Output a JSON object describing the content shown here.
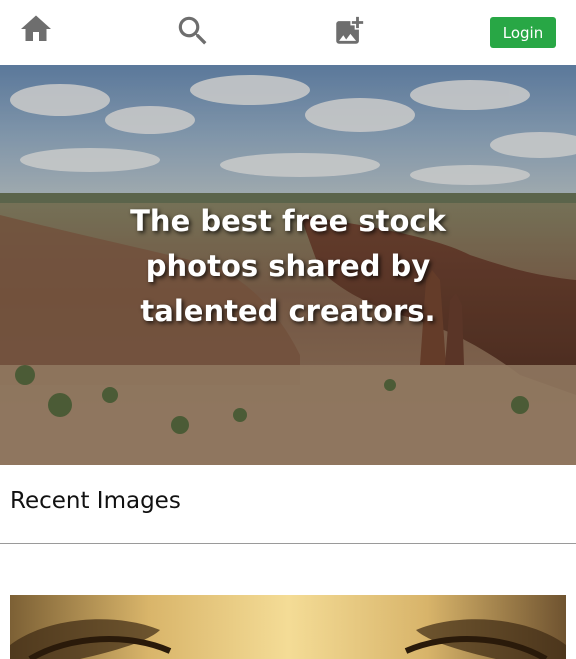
{
  "nav": {
    "home_icon": "home-icon",
    "search_icon": "search-icon",
    "add_photo_icon": "add-photo-icon",
    "login_label": "Login",
    "login_color": "#28a745"
  },
  "hero": {
    "headline": "The best free stock photos shared by talented creators."
  },
  "recent": {
    "title": "Recent Images"
  }
}
